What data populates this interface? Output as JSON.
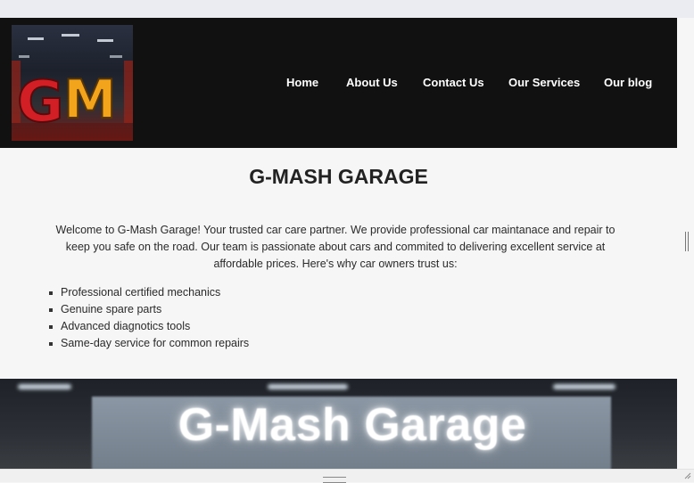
{
  "header": {
    "logo_text": "GM",
    "nav": [
      {
        "label": "Home"
      },
      {
        "label": "About Us"
      },
      {
        "label": "Contact Us"
      },
      {
        "label": "Our Services"
      },
      {
        "label": "Our blog"
      }
    ]
  },
  "main": {
    "title": "G-MASH GARAGE",
    "intro": "Welcome to G-Mash Garage! Your trusted car care partner. We provide professional car maintanace and repair to keep you safe on the road. Our team is passionate about cars and commited to delivering excellent service at affordable prices. Here's why car owners trust us:",
    "features": [
      "Professional certified mechanics",
      "Genuine spare parts",
      "Advanced diagnotics tools",
      "Same-day service for common repairs"
    ]
  },
  "banner": {
    "text": "G-Mash Garage"
  },
  "colors": {
    "header_bg": "#111111",
    "page_bg": "#f6f6f6",
    "logo_red": "#d21f26",
    "logo_gold": "#f2a51c"
  }
}
